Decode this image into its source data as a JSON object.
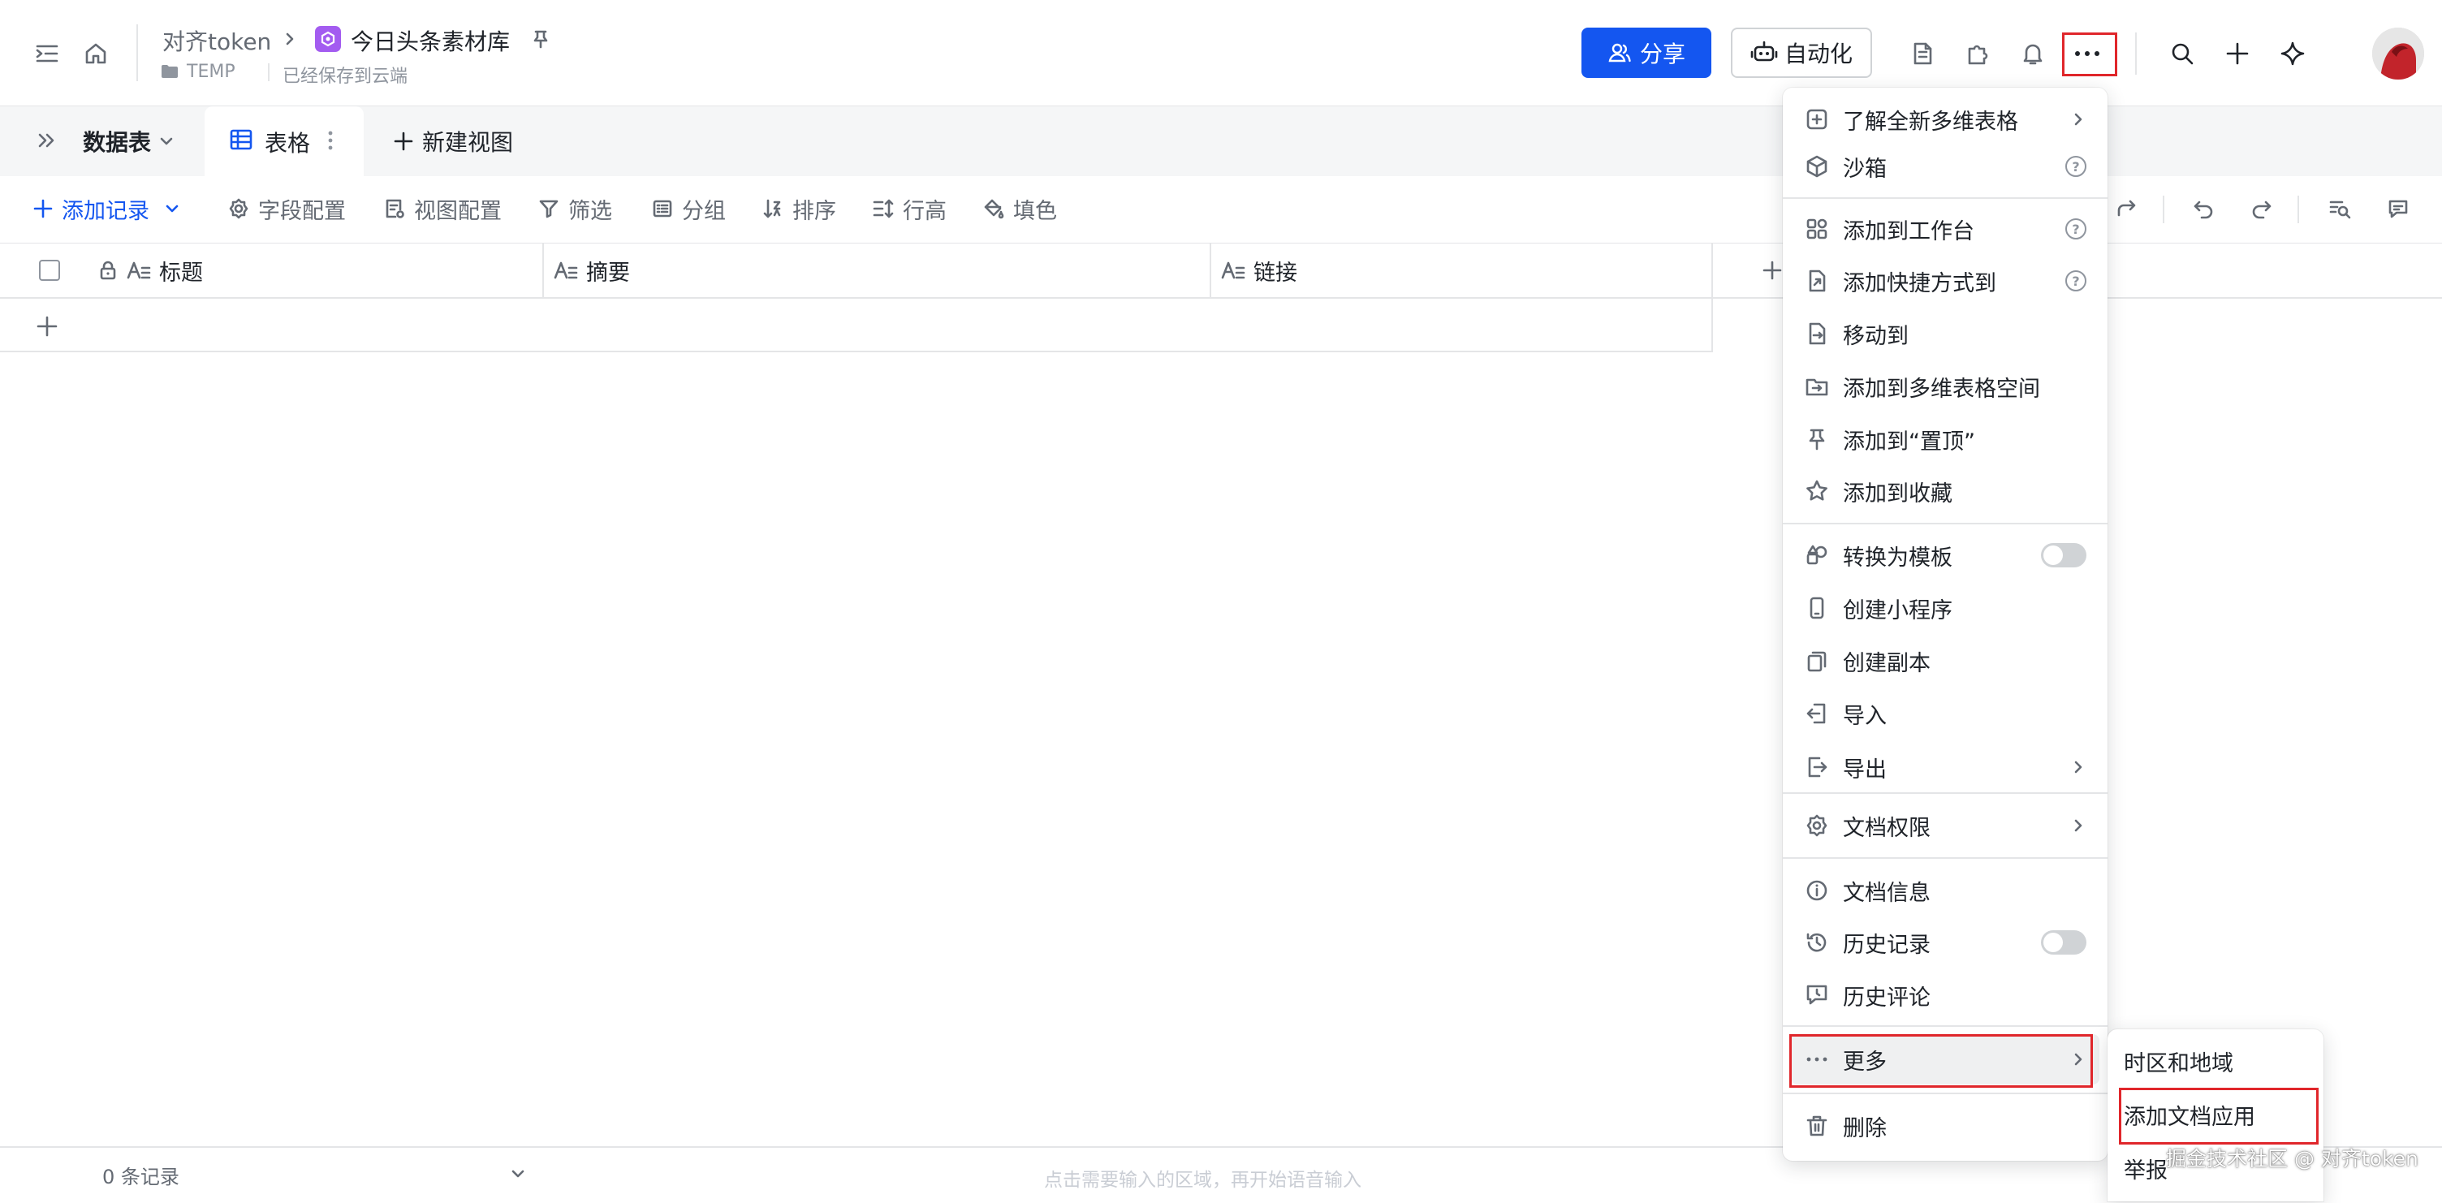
{
  "header": {
    "breadcrumb_parent": "对齐token",
    "doc_title": "今日头条素材库",
    "folder_name": "TEMP",
    "save_status": "已经保存到云端",
    "share_label": "分享",
    "automation_label": "自动化",
    "accent_color": "#1456f0"
  },
  "tabs": {
    "datatable_label": "数据表",
    "view_label": "表格",
    "new_view_label": "新建视图"
  },
  "toolbar": {
    "add_record": "添加记录",
    "field_config": "字段配置",
    "view_config": "视图配置",
    "filter": "筛选",
    "group": "分组",
    "sort": "排序",
    "row_height": "行高",
    "fill_color": "填色"
  },
  "grid": {
    "columns": [
      "标题",
      "摘要",
      "链接"
    ]
  },
  "footer": {
    "record_count": "0 条记录",
    "voice_hint": "点击需要输入的区域，再开始语音输入"
  },
  "menu": {
    "items": [
      {
        "label": "了解全新多维表格",
        "icon": "bitable-icon"
      },
      {
        "label": "沙箱",
        "icon": "cube-icon"
      },
      {
        "label": "添加到工作台",
        "icon": "workspace-icon"
      },
      {
        "label": "添加快捷方式到",
        "icon": "shortcut-icon"
      },
      {
        "label": "移动到",
        "icon": "move-icon"
      },
      {
        "label": "添加到多维表格空间",
        "icon": "space-icon"
      },
      {
        "label": "添加到“置顶”",
        "icon": "pin-icon"
      },
      {
        "label": "添加到收藏",
        "icon": "star-icon"
      },
      {
        "label": "转换为模板",
        "icon": "template-icon"
      },
      {
        "label": "创建小程序",
        "icon": "miniapp-icon"
      },
      {
        "label": "创建副本",
        "icon": "copy-icon"
      },
      {
        "label": "导入",
        "icon": "import-icon"
      },
      {
        "label": "导出",
        "icon": "export-icon"
      },
      {
        "label": "文档权限",
        "icon": "gear-icon"
      },
      {
        "label": "文档信息",
        "icon": "info-icon"
      },
      {
        "label": "历史记录",
        "icon": "history-icon"
      },
      {
        "label": "历史评论",
        "icon": "comment-history-icon"
      },
      {
        "label": "更多",
        "icon": "more-icon"
      },
      {
        "label": "删除",
        "icon": "trash-icon"
      }
    ]
  },
  "submenu": {
    "items": [
      "时区和地域",
      "添加文档应用",
      "举报"
    ]
  },
  "watermark": "掘金技术社区 @ 对齐token",
  "highlight_color": "#e0262b"
}
